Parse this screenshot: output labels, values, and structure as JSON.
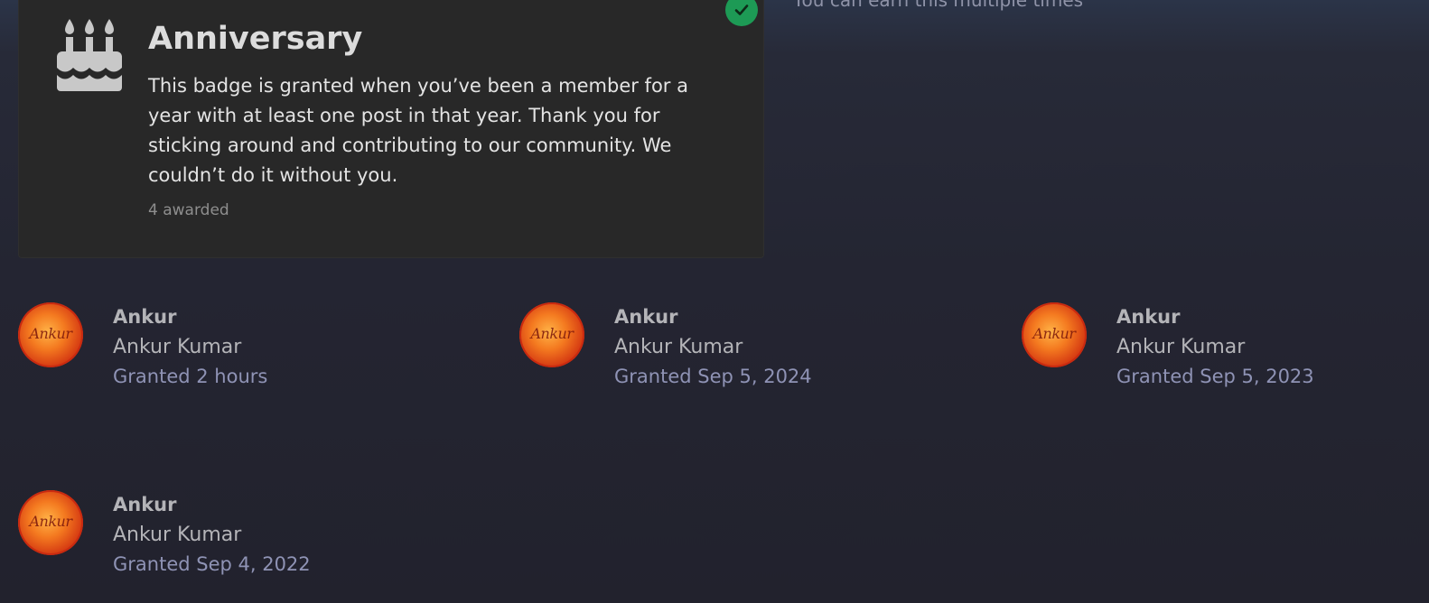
{
  "header": {
    "multiple_note": "You can earn this multiple times"
  },
  "badge": {
    "title": "Anniversary",
    "icon": "birthday-cake-icon",
    "description": "This badge is granted when you’ve been a member for a year with at least one post in that year. Thank you for sticking around and contributing to our community. We couldn’t do it without you.",
    "awarded_count": "4 awarded",
    "status_icon": "check-icon",
    "status_color": "#1d9a55"
  },
  "grantees": [
    {
      "username": "Ankur",
      "full_name": "Ankur Kumar",
      "granted": "Granted 2 hours",
      "avatar_text": "Ankur"
    },
    {
      "username": "Ankur",
      "full_name": "Ankur Kumar",
      "granted": "Granted Sep 5, 2024",
      "avatar_text": "Ankur"
    },
    {
      "username": "Ankur",
      "full_name": "Ankur Kumar",
      "granted": "Granted Sep 5, 2023",
      "avatar_text": "Ankur"
    },
    {
      "username": "Ankur",
      "full_name": "Ankur Kumar",
      "granted": "Granted Sep 4, 2022",
      "avatar_text": "Ankur"
    }
  ]
}
